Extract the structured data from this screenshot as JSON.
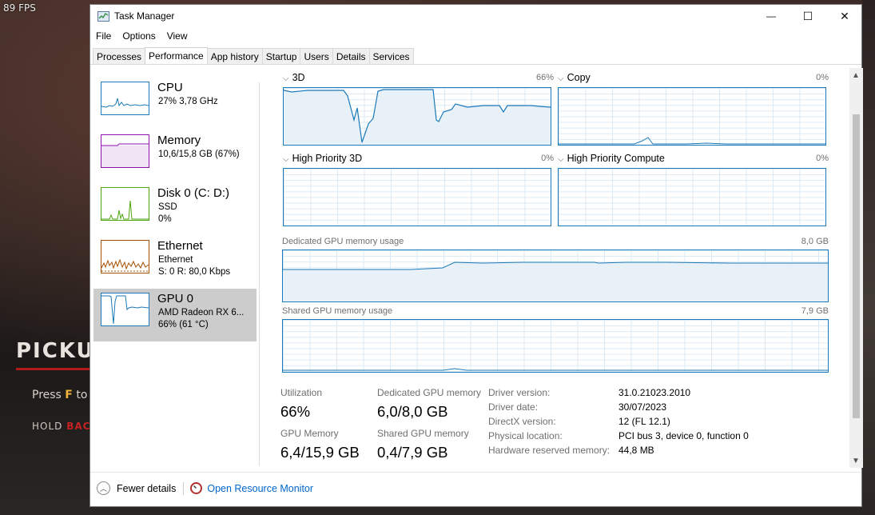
{
  "game": {
    "fps": "89 FPS",
    "pickup": "PICKU",
    "press_prefix": "Press ",
    "press_key": "F",
    "press_suffix": " to",
    "hold_prefix": "HOLD ",
    "hold_red": "BACK"
  },
  "window": {
    "title": "Task Manager",
    "minimize": "—",
    "maximize": "☐",
    "close": "✕"
  },
  "menu": [
    "File",
    "Options",
    "View"
  ],
  "tabs": [
    "Processes",
    "Performance",
    "App history",
    "Startup",
    "Users",
    "Details",
    "Services"
  ],
  "active_tab": "Performance",
  "sidebar": [
    {
      "name": "CPU",
      "line1": "27%  3,78 GHz",
      "line2": "",
      "color": "#1b7ab9"
    },
    {
      "name": "Memory",
      "line1": "10,6/15,8 GB (67%)",
      "line2": "",
      "color": "#8b12ae"
    },
    {
      "name": "Disk 0 (C: D:)",
      "line1": "SSD",
      "line2": "0%",
      "color": "#4da60c"
    },
    {
      "name": "Ethernet",
      "line1": "Ethernet",
      "line2": "S: 0  R: 80,0 Kbps",
      "color": "#a74f01"
    },
    {
      "name": "GPU 0",
      "line1": "AMD Radeon RX 6...",
      "line2": "66% (61 °C)",
      "color": "#1b7ab9",
      "selected": true
    }
  ],
  "engines": [
    {
      "label": "3D",
      "percent": "66%"
    },
    {
      "label": "Copy",
      "percent": "0%"
    },
    {
      "label": "High Priority 3D",
      "percent": "0%"
    },
    {
      "label": "High Priority Compute",
      "percent": "0%"
    }
  ],
  "dedicated": {
    "label": "Dedicated GPU memory usage",
    "max": "8,0 GB"
  },
  "shared": {
    "label": "Shared GPU memory usage",
    "max": "7,9 GB"
  },
  "stats": {
    "utilization_label": "Utilization",
    "utilization_value": "66%",
    "dedicated_label": "Dedicated GPU memory",
    "dedicated_value": "6,0/8,0 GB",
    "gpu_memory_label": "GPU Memory",
    "gpu_memory_value": "6,4/15,9 GB",
    "shared_label": "Shared GPU memory",
    "shared_value": "0,4/7,9 GB"
  },
  "info": [
    {
      "label": "Driver version:",
      "value": "31.0.21023.2010"
    },
    {
      "label": "Driver date:",
      "value": "30/07/2023"
    },
    {
      "label": "DirectX version:",
      "value": "12 (FL 12.1)"
    },
    {
      "label": "Physical location:",
      "value": "PCI bus 3, device 0, function 0"
    },
    {
      "label": "Hardware reserved memory:",
      "value": "44,8 MB"
    }
  ],
  "footer": {
    "fewer_details": "Fewer details",
    "resource_monitor": "Open Resource Monitor"
  }
}
